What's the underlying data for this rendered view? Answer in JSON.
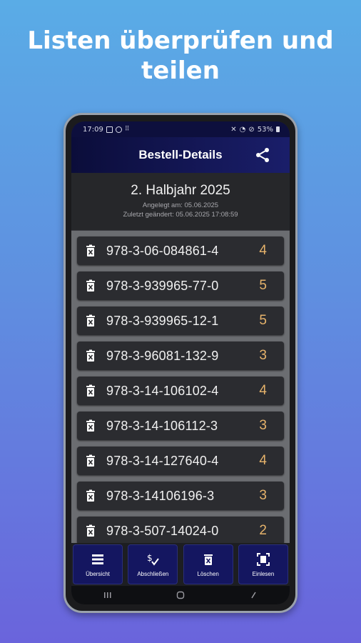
{
  "promo": {
    "headline_line1": "Listen überprüfen und",
    "headline_line2": "teilen"
  },
  "status_bar": {
    "time": "17:09",
    "battery": "53%"
  },
  "app_bar": {
    "title": "Bestell-Details",
    "share_icon": "share-icon"
  },
  "order": {
    "title": "2. Halbjahr 2025",
    "created": "Angelegt am: 05.06.2025",
    "modified": "Zuletzt geändert: 05.06.2025 17:08:59"
  },
  "items": [
    {
      "isbn": "978-3-06-084861-4",
      "qty": "4"
    },
    {
      "isbn": "978-3-939965-77-0",
      "qty": "5"
    },
    {
      "isbn": "978-3-939965-12-1",
      "qty": "5"
    },
    {
      "isbn": "978-3-96081-132-9",
      "qty": "3"
    },
    {
      "isbn": "978-3-14-106102-4",
      "qty": "4"
    },
    {
      "isbn": "978-3-14-106112-3",
      "qty": "3"
    },
    {
      "isbn": "978-3-14-127640-4",
      "qty": "4"
    },
    {
      "isbn": "978-3-14106196-3",
      "qty": "3"
    },
    {
      "isbn": "978-3-507-14024-0",
      "qty": "2"
    }
  ],
  "actions": [
    {
      "label": "Übersicht",
      "icon": "list-icon"
    },
    {
      "label": "Abschließen",
      "icon": "sign-check-icon"
    },
    {
      "label": "Löschen",
      "icon": "trash-icon"
    },
    {
      "label": "Einlesen",
      "icon": "scan-icon"
    }
  ],
  "colors": {
    "accent": "#141660",
    "quantity": "#e6b36b",
    "appbar": "#0b0d3a"
  }
}
